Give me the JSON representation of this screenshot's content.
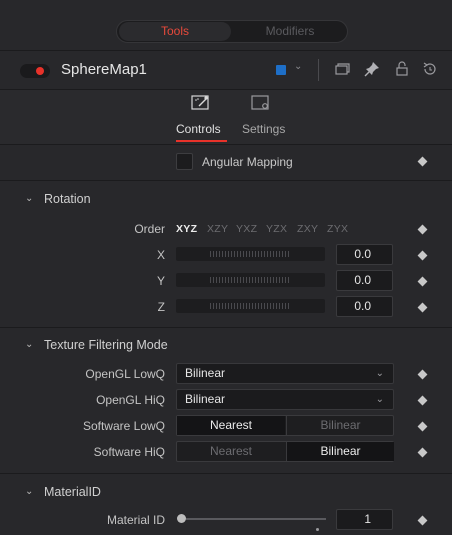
{
  "tabs": {
    "tools": "Tools",
    "modifiers": "Modifiers"
  },
  "node": {
    "name": "SphereMap1",
    "color": "#1e6fc8",
    "enabled": true
  },
  "header_icons": [
    "versions-icon",
    "pin-icon",
    "lock-icon",
    "reset-icon"
  ],
  "control_tabs": {
    "controls": "Controls",
    "settings": "Settings",
    "active": "Controls"
  },
  "angular_mapping": {
    "label": "Angular Mapping",
    "checked": false
  },
  "rotation": {
    "title": "Rotation",
    "order_label": "Order",
    "orders": [
      "XYZ",
      "XZY",
      "YXZ",
      "YZX",
      "ZXY",
      "ZYX"
    ],
    "selected_order": "XYZ",
    "x": {
      "label": "X",
      "value": "0.0"
    },
    "y": {
      "label": "Y",
      "value": "0.0"
    },
    "z": {
      "label": "Z",
      "value": "0.0"
    }
  },
  "texture_filtering": {
    "title": "Texture Filtering Mode",
    "opengl_lowq": {
      "label": "OpenGL LowQ",
      "value": "Bilinear"
    },
    "opengl_hiq": {
      "label": "OpenGL HiQ",
      "value": "Bilinear"
    },
    "software_lowq": {
      "label": "Software LowQ",
      "options": [
        "Nearest",
        "Bilinear"
      ],
      "selected": "Nearest"
    },
    "software_hiq": {
      "label": "Software HiQ",
      "options": [
        "Nearest",
        "Bilinear"
      ],
      "selected": "Bilinear"
    }
  },
  "material": {
    "title": "MaterialID",
    "material_id": {
      "label": "Material ID",
      "value": "1"
    }
  },
  "colors": {
    "accent_red": "#e8322a",
    "background": "#28282b"
  }
}
